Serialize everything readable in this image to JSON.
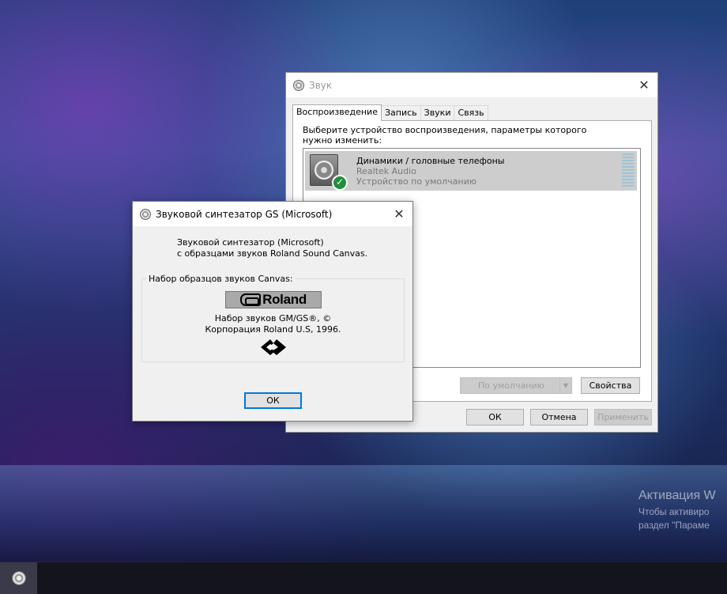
{
  "desktop": {
    "activation_title": "Активация W",
    "activation_line1": "Чтобы активиро",
    "activation_line2": "раздел \"Параме"
  },
  "sound_dialog": {
    "title": "Звук",
    "tabs": [
      "Воспроизведение",
      "Запись",
      "Звуки",
      "Связь"
    ],
    "instruction": "Выберите устройство воспроизведения, параметры которого нужно изменить:",
    "device": {
      "name": "Динамики / головные телефоны",
      "driver": "Realtek Audio",
      "status": "Устройство по умолчанию"
    },
    "set_default_label": "По умолчанию",
    "properties_label": "Свойства",
    "ok_label": "ОК",
    "cancel_label": "Отмена",
    "apply_label": "Применить"
  },
  "gs_dialog": {
    "title": "Звуковой синтезатор GS (Microsoft)",
    "desc_line1": "Звуковой синтезатор (Microsoft)",
    "desc_line2": "с образцами звуков Roland Sound Canvas.",
    "group_label": "Набор образцов звуков Canvas:",
    "logo_text": "Roland",
    "copyright_line1": "Набор звуков GM/GS®, ©",
    "copyright_line2": "Корпорация Roland U.S, 1996.",
    "ok_label": "ОК"
  }
}
